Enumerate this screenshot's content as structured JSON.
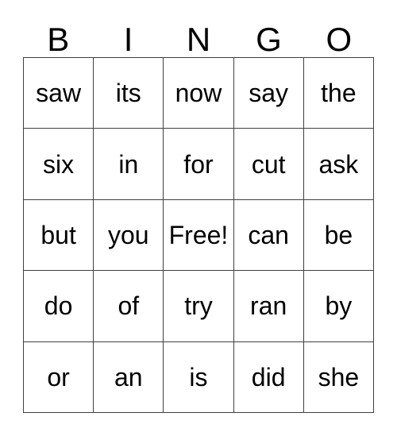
{
  "card": {
    "title": "BINGO",
    "headers": [
      "B",
      "I",
      "N",
      "G",
      "O"
    ],
    "free_space_label": "Free!",
    "grid_line_color": "#404040",
    "text_color": "#000000",
    "background_color": "#ffffff",
    "rows": [
      [
        "saw",
        "its",
        "now",
        "say",
        "the"
      ],
      [
        "six",
        "in",
        "for",
        "cut",
        "ask"
      ],
      [
        "but",
        "you",
        "Free!",
        "can",
        "be"
      ],
      [
        "do",
        "of",
        "try",
        "ran",
        "by"
      ],
      [
        "or",
        "an",
        "is",
        "did",
        "she"
      ]
    ]
  }
}
